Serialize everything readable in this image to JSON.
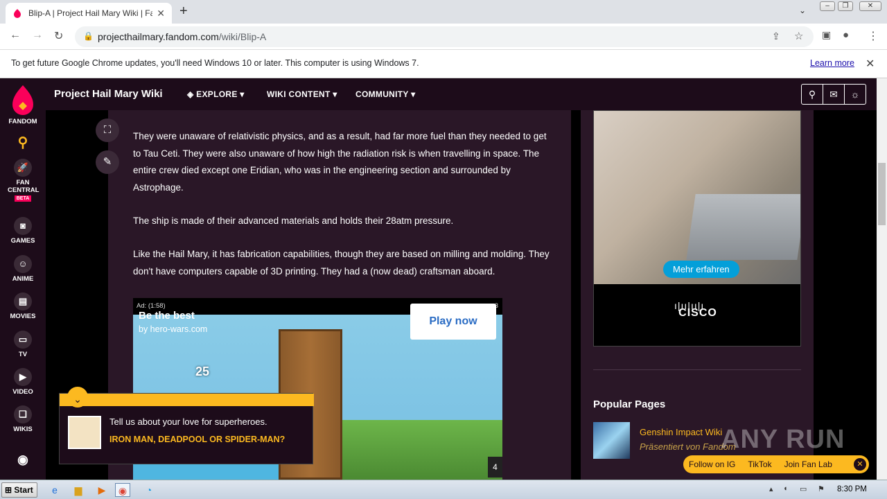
{
  "browser": {
    "tab_title": "Blip-A | Project Hail Mary Wiki | Fand",
    "tab_close": "✕",
    "new_tab": "+",
    "url_host": "projecthailmary.fandom.com",
    "url_path": "/wiki/Blip-A",
    "infobar_text": "To get future Google Chrome updates, you'll need Windows 10 or later. This computer is using Windows 7.",
    "learn_more": "Learn more"
  },
  "rail": {
    "fandom": "FANDOM",
    "fan_central": "FAN CENTRAL",
    "beta": "BETA",
    "games": "GAMES",
    "anime": "ANIME",
    "movies": "MOVIES",
    "tv": "TV",
    "video": "VIDEO",
    "wikis": "WIKIS"
  },
  "header": {
    "wiki_name": "Project Hail Mary Wiki",
    "explore": "EXPLORE",
    "wiki_content": "WIKI CONTENT",
    "community": "COMMUNITY"
  },
  "article": {
    "p1": "They were unaware of relativistic physics, and as a result, had far more fuel than they needed to get to Tau Ceti. They were also unaware of how high the radiation risk is when travelling in space. The entire crew died except one Eridian, who was in the engineering section and surrounded by Astrophage.",
    "p2": "The ship is made of their advanced materials and holds their 28atm pressure.",
    "p3": "Like the Hail Mary, it has fabrication capabilities, though they are based on milling and molding. They don't have computers capable of 3D printing. They had a (now dead) craftsman aboard."
  },
  "video_ad": {
    "label": "Ad: (1:58)",
    "count": "3",
    "headline": "Be the best",
    "source": "by hero-wars.com",
    "cta": "Play now",
    "score": "25",
    "page": "4"
  },
  "side_ad": {
    "button": "Mehr erfahren",
    "brand": "CISCO"
  },
  "popular": {
    "heading": "Popular Pages",
    "item_title": "Genshin Impact Wiki",
    "item_sub": "Präsentiert von Fandom"
  },
  "popup": {
    "text": "Tell us about your love for superheroes.",
    "link": "IRON MAN, DEADPOOL OR SPIDER-MAN?"
  },
  "follow": {
    "ig": "Follow on IG",
    "tiktok": "TikTok",
    "fanlab": "Join Fan Lab"
  },
  "watermark": "ANY RUN",
  "taskbar": {
    "start": "Start",
    "time": "8:30 PM"
  },
  "colors": {
    "fandom_bg": "#1d0c1a",
    "content_bg": "#2a1727",
    "accent_yellow": "#fcb920",
    "cisco_blue": "#049fd9"
  }
}
